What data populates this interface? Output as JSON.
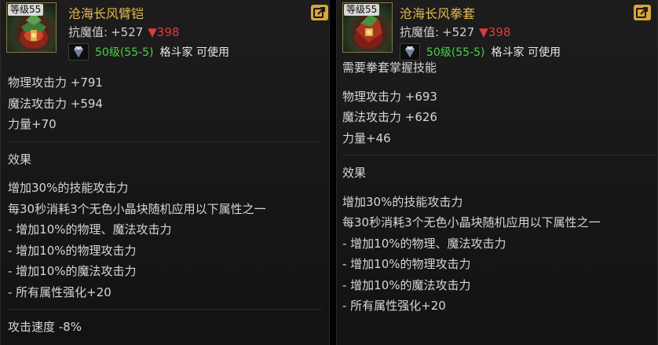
{
  "left": {
    "level_badge": "等级55",
    "name": "沧海长风臂铠",
    "resist_label": "抗魔值:",
    "resist_gain": "+527",
    "resist_drop": "▼398",
    "req_level": "50级(55-5)",
    "req_class": "格斗家 可使用",
    "stats": [
      "物理攻击力 +791",
      "魔法攻击力 +594",
      "力量+70"
    ],
    "effect_title": "效果",
    "effects": [
      "增加30%的技能攻击力",
      "每30秒消耗3个无色小晶块随机应用以下属性之一",
      "- 增加10%的物理、魔法攻击力",
      "- 增加10%的物理攻击力",
      "- 增加10%的魔法攻击力",
      "- 所有属性强化+20"
    ],
    "extra": "攻击速度 -8%"
  },
  "right": {
    "level_badge": "等级55",
    "name": "沧海长风拳套",
    "resist_label": "抗魔值:",
    "resist_gain": "+527",
    "resist_drop": "▼398",
    "req_level": "50级(55-5)",
    "req_class": "格斗家 可使用",
    "requirement_note": "需要拳套掌握技能",
    "stats": [
      "物理攻击力 +693",
      "魔法攻击力 +626",
      "力量+46"
    ],
    "effect_title": "效果",
    "effects": [
      "增加30%的技能攻击力",
      "每30秒消耗3个无色小晶块随机应用以下属性之一",
      "- 增加10%的物理、魔法攻击力",
      "- 增加10%的物理攻击力",
      "- 增加10%的魔法攻击力",
      "- 所有属性强化+20"
    ]
  },
  "icons": {
    "share": "share-icon",
    "gem": "gem-icon",
    "item_left": "arm-guard-icon",
    "item_right": "gauntlet-icon"
  },
  "colors": {
    "item_name": "#e6b84e",
    "resist_drop": "#e23a3a",
    "req_level": "#4fcf4a",
    "share_button": "#d9a53a"
  }
}
